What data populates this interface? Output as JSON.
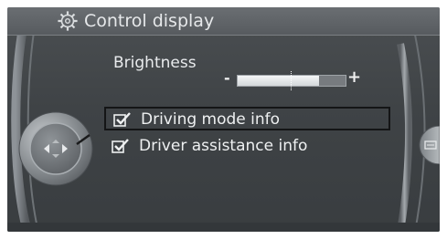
{
  "screen": {
    "title": "Control display",
    "title_icon": "gear-icon"
  },
  "brightness": {
    "label": "Brightness",
    "minus": "-",
    "plus": "+",
    "level": 0.75,
    "colors": {
      "fill": "#f4f6f7",
      "track": "#777b7f"
    }
  },
  "options": [
    {
      "label": "Driving mode info",
      "checked": true,
      "selected": true
    },
    {
      "label": "Driver assistance info",
      "checked": true,
      "selected": false
    }
  ],
  "colors": {
    "background": "#3f4346",
    "title_bar": "#5f6367",
    "text": "#eef0f1",
    "selection_frame": "#141516"
  },
  "icons": {
    "controller": "controller-knob-icon",
    "check": "checkbox-checked-icon",
    "side_button": "options-button-icon"
  }
}
